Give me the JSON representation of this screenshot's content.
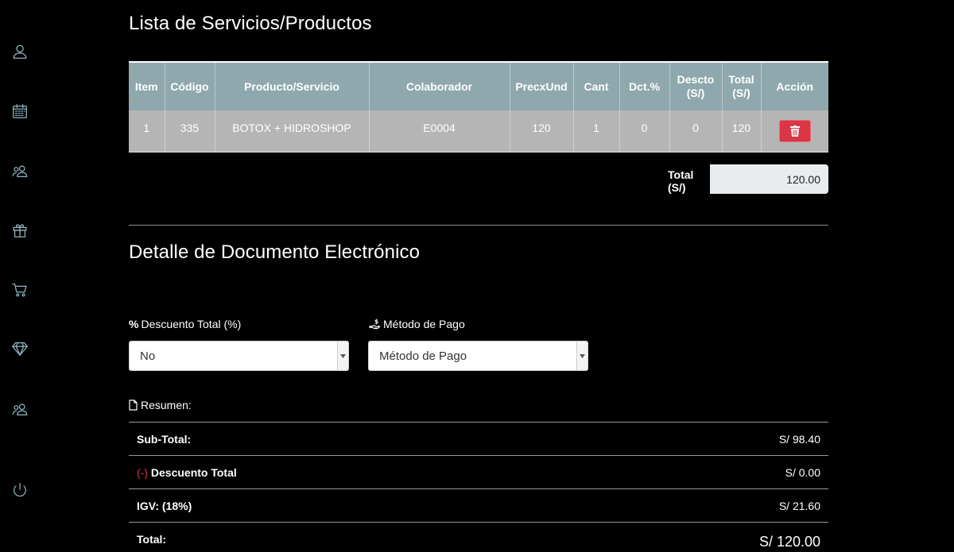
{
  "sidebar": {
    "items": [
      {
        "icon": "user-icon"
      },
      {
        "icon": "calendar-icon"
      },
      {
        "icon": "clients-icon"
      },
      {
        "icon": "gift-icon"
      },
      {
        "icon": "cart-icon"
      },
      {
        "icon": "diamond-icon"
      },
      {
        "icon": "team-icon"
      },
      {
        "icon": "power-icon"
      }
    ]
  },
  "products": {
    "title": "Lista de Servicios/Productos",
    "headers": {
      "item": "Item",
      "code": "Código",
      "product": "Producto/Servicio",
      "collaborator": "Colaborador",
      "unit_price": "PrecxUnd",
      "qty": "Cant",
      "discount_pct_l1": "Dct.%",
      "discount_l1": "Descto",
      "discount_l2": "(S/)",
      "total_l1": "Total",
      "total_l2": "(S/)",
      "action": "Acción"
    },
    "rows": [
      {
        "item": "1",
        "code": "335",
        "product": "BOTOX + HIDROSHOP",
        "collaborator": "E0004",
        "unit_price": "120",
        "qty": "1",
        "discount_pct": "0",
        "discount": "0",
        "total": "120"
      }
    ],
    "total_label": "Total (S/)",
    "total_value": "120.00"
  },
  "document": {
    "title": "Detalle de Documento Electrónico",
    "discount_label": "Descuento Total (%)",
    "discount_icon_glyph": "%",
    "discount_selected": "No",
    "payment_label": "Método de Pago",
    "payment_selected": "Método de Pago",
    "summary_label": "Resumen:",
    "summary": {
      "subtotal_label": "Sub-Total:",
      "subtotal_value": "S/ 98.40",
      "discount_prefix": "(-)",
      "discount_label": "Descuento Total",
      "discount_value": "S/ 0.00",
      "igv_label": "IGV: (18%)",
      "igv_value": "S/ 21.60",
      "total_label": "Total:",
      "total_value": "S/ 120.00"
    }
  },
  "colors": {
    "header_bg": "#8fa8ad",
    "row_bg": "#b5b5b5",
    "danger": "#dc3545",
    "icon": "#8fb3bf"
  }
}
